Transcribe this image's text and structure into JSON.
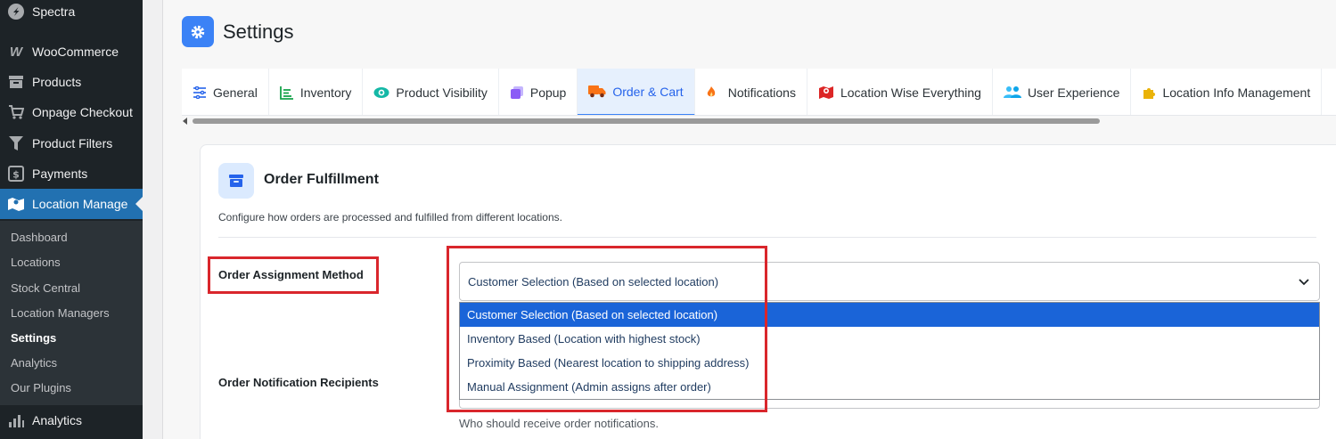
{
  "sidebar": {
    "top_items": [
      {
        "label": "Spectra",
        "icon": "spectra-icon"
      },
      {
        "label": "WooCommerce",
        "icon": "woocommerce-icon"
      },
      {
        "label": "Products",
        "icon": "archive-icon"
      },
      {
        "label": "Onpage Checkout",
        "icon": "cart-icon"
      },
      {
        "label": "Product Filters",
        "icon": "filter-icon"
      },
      {
        "label": "Payments",
        "icon": "payments-icon"
      },
      {
        "label": "Location Manage",
        "icon": "map-icon"
      }
    ],
    "submenu": [
      "Dashboard",
      "Locations",
      "Stock Central",
      "Location Managers",
      "Settings",
      "Analytics",
      "Our Plugins"
    ],
    "bottom_item": {
      "label": "Analytics",
      "icon": "bar-chart-icon"
    }
  },
  "header": {
    "title": "Settings"
  },
  "tabs": [
    {
      "label": "General",
      "icon": "sliders-icon"
    },
    {
      "label": "Inventory",
      "icon": "list-icon"
    },
    {
      "label": "Product Visibility",
      "icon": "eye-icon"
    },
    {
      "label": "Popup",
      "icon": "popup-icon"
    },
    {
      "label": "Order & Cart",
      "icon": "truck-icon"
    },
    {
      "label": "Notifications",
      "icon": "flame-icon"
    },
    {
      "label": "Location Wise Everything",
      "icon": "map-pin-icon"
    },
    {
      "label": "User Experience",
      "icon": "users-icon"
    },
    {
      "label": "Location Info Management",
      "icon": "puzzle-icon"
    }
  ],
  "card": {
    "title": "Order Fulfillment",
    "description": "Configure how orders are processed and fulfilled from different locations."
  },
  "fields": {
    "assignment": {
      "label": "Order Assignment Method",
      "value": "Customer Selection (Based on selected location)",
      "options": [
        "Customer Selection (Based on selected location)",
        "Inventory Based (Location with highest stock)",
        "Proximity Based (Nearest location to shipping address)",
        "Manual Assignment (Admin assigns after order)"
      ]
    },
    "recipients": {
      "label": "Order Notification Recipients",
      "help": "Who should receive order notifications."
    }
  },
  "colors": {
    "sidebar_bg": "#1d2327",
    "accent": "#2271b1",
    "tab_active": "#2563eb",
    "option_selected": "#1a64d8",
    "highlight": "#d9262c"
  }
}
